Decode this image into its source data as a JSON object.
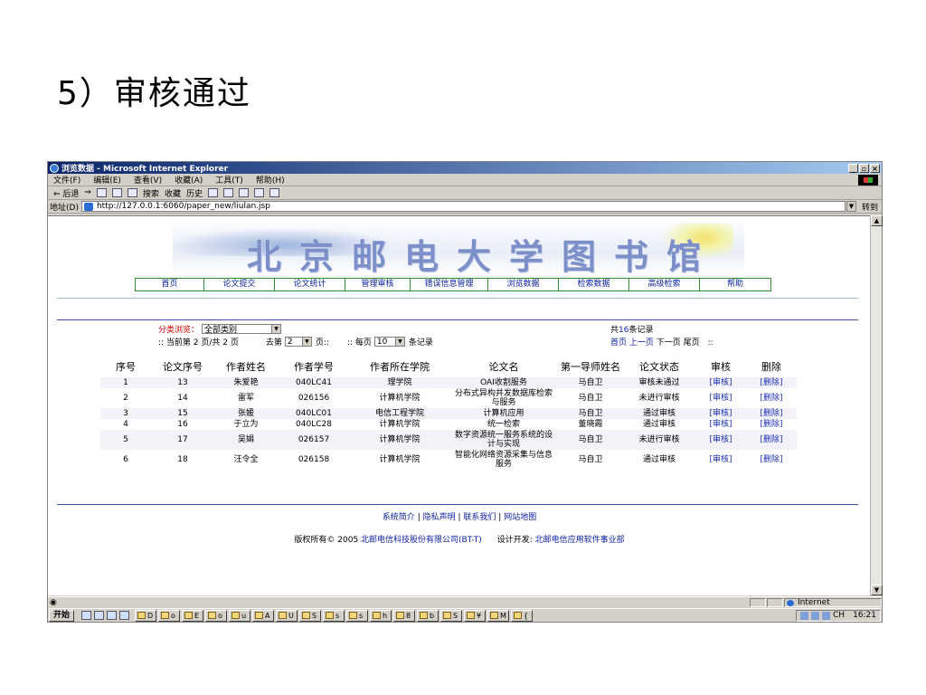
{
  "slide": {
    "title": "5）审核通过"
  },
  "window": {
    "title": "浏览数据 - Microsoft Internet Explorer",
    "buttons": {
      "minimize": "_",
      "maximize": "▫",
      "close": "×"
    }
  },
  "menu": [
    "文件(F)",
    "编辑(E)",
    "查看(V)",
    "收藏(A)",
    "工具(T)",
    "帮助(H)"
  ],
  "toolbar": {
    "back": "⇐ 后退",
    "forward": "⇒",
    "search": "搜索",
    "favorites": "收藏",
    "history": "历史"
  },
  "address": {
    "label": "地址(D)",
    "url": "http://127.0.0.1:6060/paper_new/liulan.jsp",
    "go": "转到"
  },
  "banner": {
    "title": "北京邮电大学图书馆"
  },
  "nav": [
    "首页",
    "论文提交",
    "论文统计",
    "管理审核",
    "错误信息管理",
    "浏览数据",
    "检索数据",
    "高级检索",
    "帮助"
  ],
  "filter": {
    "label": "分类浏览：",
    "value": "全部类别"
  },
  "pager": {
    "current_text": ":: 当前第 2 页/共 2 页",
    "goto_prefix": "去第",
    "goto_value": "2",
    "goto_suffix": "页::",
    "per_page_prefix": ":: 每页",
    "per_page_value": "10",
    "per_page_suffix": "条记录",
    "total_prefix": "共",
    "total_count": "16",
    "total_suffix": "条记录",
    "first": "首页",
    "prev": "上一页",
    "next": "下一页",
    "last": "尾页",
    "tail": "::"
  },
  "table": {
    "headers": [
      "序号",
      "论文序号",
      "作者姓名",
      "作者学号",
      "作者所在学院",
      "论文名",
      "第一导师姓名",
      "论文状态",
      "审核",
      "删除"
    ],
    "rows": [
      [
        "1",
        "13",
        "朱爱艳",
        "040LC41",
        "理学院",
        "OAI收割服务",
        "马自卫",
        "审核未通过",
        "[审核]",
        "[删除]"
      ],
      [
        "2",
        "14",
        "雷军",
        "026156",
        "计算机学院",
        "分布式异构并发数据库检索与服务",
        "马自卫",
        "未进行审核",
        "[审核]",
        "[删除]"
      ],
      [
        "3",
        "15",
        "张媛",
        "040LC01",
        "电信工程学院",
        "计算机应用",
        "马自卫",
        "通过审核",
        "[审核]",
        "[删除]"
      ],
      [
        "4",
        "16",
        "于立为",
        "040LC28",
        "计算机学院",
        "统一检索",
        "董晓霞",
        "通过审核",
        "[审核]",
        "[删除]"
      ],
      [
        "5",
        "17",
        "吴娟",
        "026157",
        "计算机学院",
        "数字资源统一服务系统的设计与实现",
        "马自卫",
        "未进行审核",
        "[审核]",
        "[删除]"
      ],
      [
        "6",
        "18",
        "汪令全",
        "026158",
        "计算机学院",
        "智能化网络资源采集与信息服务",
        "马自卫",
        "通过审核",
        "[审核]",
        "[删除]"
      ]
    ]
  },
  "footer": {
    "links": [
      "系统简介",
      "隐私声明",
      "联系我们",
      "网站地图"
    ],
    "copyright_prefix": "版权所有© 2005",
    "company": "北邮电信科技股份有限公司(BT-T)",
    "dev_label": "设计开发:",
    "developer": "北邮电信应用软件事业部"
  },
  "status": {
    "zone": "Internet"
  },
  "taskbar": {
    "start": "开始",
    "tasks": [
      "D",
      "o",
      "E",
      "o",
      "u",
      "A",
      "U",
      "S",
      "s",
      "s",
      "h",
      "8",
      "b",
      "S",
      "¥",
      "M",
      "{"
    ],
    "lang": "CH",
    "clock": "16:21"
  }
}
